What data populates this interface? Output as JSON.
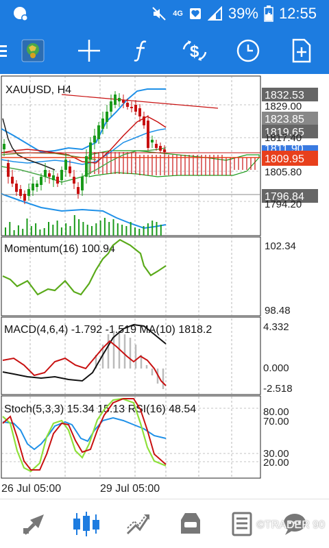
{
  "status_bar": {
    "network": "4G",
    "battery": "39%",
    "time": "12:55",
    "icons": [
      "notification-icon",
      "mute-icon",
      "signal-icon",
      "battery-icon"
    ]
  },
  "toolbar": {
    "icons": [
      "menu-icon",
      "symbol-icon",
      "crosshair-icon",
      "function-icon",
      "trade-icon",
      "clock-icon",
      "new-order-icon"
    ]
  },
  "chart": {
    "symbol_title": "XAUUSD, H4",
    "price_labels": [
      "1832.53",
      "1829.00",
      "1823.85",
      "1819.65",
      "1817.40",
      "1811.90",
      "1809.95",
      "1805.80",
      "1796.84",
      "1794.20"
    ],
    "momentum": {
      "title": "Momentum(16) 100.94",
      "top": "102.34",
      "bottom": "98.48"
    },
    "macd": {
      "title": "MACD(4,6,4) -1.792 -1.519 MA(10) 1818.2",
      "top": "4.332",
      "mid": "0.000",
      "bottom": "-2.518"
    },
    "stoch": {
      "title": "Stoch(5,3,3) 15.34 15.13 RSI(16) 48.54",
      "l80": "80.00",
      "l70": "70.00",
      "l30": "30.00",
      "l20": "20.00"
    },
    "time_labels": [
      "26 Jul 05:00",
      "29 Jul 05:00"
    ],
    "colors": {
      "up": "#1a9a1a",
      "down": "#c81010",
      "bb": "#1e90e8",
      "cloud": "#c81010",
      "price_box": "#666666",
      "price_box_current": "#e8401c"
    }
  },
  "bottom_nav": {
    "icons": [
      "quotes-icon",
      "chart-icon",
      "trade-icon",
      "history-icon",
      "news-icon",
      "chat-icon"
    ]
  },
  "watermark": "©TRADER 90"
}
